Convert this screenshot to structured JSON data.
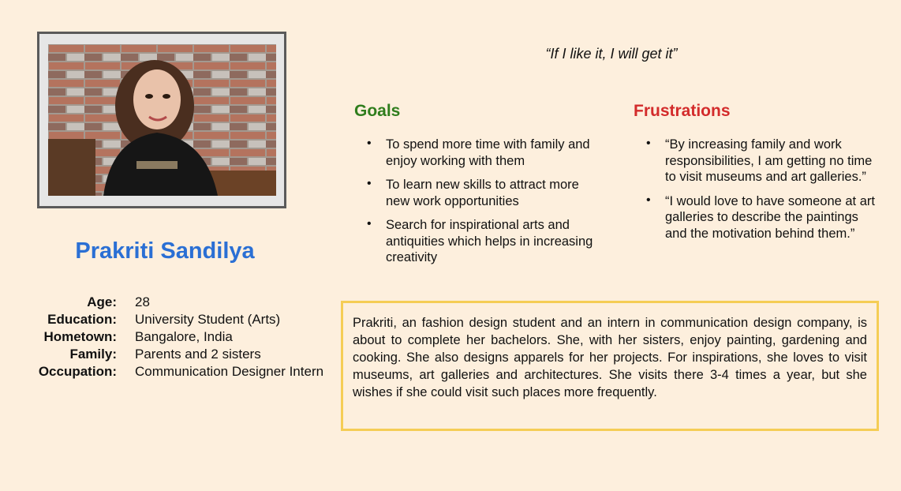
{
  "persona": {
    "name": "Prakriti Sandilya",
    "details": [
      {
        "label": "Age:",
        "value": "28"
      },
      {
        "label": "Education:",
        "value": "University Student (Arts)"
      },
      {
        "label": "Hometown:",
        "value": "Bangalore, India"
      },
      {
        "label": "Family:",
        "value": "Parents and 2 sisters"
      },
      {
        "label": "Occupation:",
        "value": "Communication Designer Intern"
      }
    ],
    "quote": "“If I like it, I will get it”",
    "goals": {
      "title": "Goals",
      "color": "#2f7d1c",
      "items": [
        "To spend more time with family and enjoy working with them",
        "To learn new skills to attract more new work opportunities",
        "Search for inspirational arts and antiquities which helps in increasing creativity"
      ]
    },
    "frustrations": {
      "title": "Frustrations",
      "color": "#d32b2b",
      "items": [
        "“By increasing family and work responsibilities, I am getting no time to visit museums and art galleries.”",
        "“I would love to have someone at art galleries to describe the paintings and the motivation behind them.”"
      ]
    },
    "bio": "Prakriti, an fashion design student and an intern in communication design company, is about to complete her bachelors. She, with her sisters, enjoy painting, gardening and cooking. She also designs apparels for her projects. For inspirations, she loves to visit museums, art galleries and architectures. She visits there 3-4 times a year, but she wishes if she could visit such places more frequently.",
    "bullet": "•"
  },
  "colors": {
    "background": "#fdefdd",
    "name": "#2a6fd4",
    "box_border": "#f5cd55"
  }
}
